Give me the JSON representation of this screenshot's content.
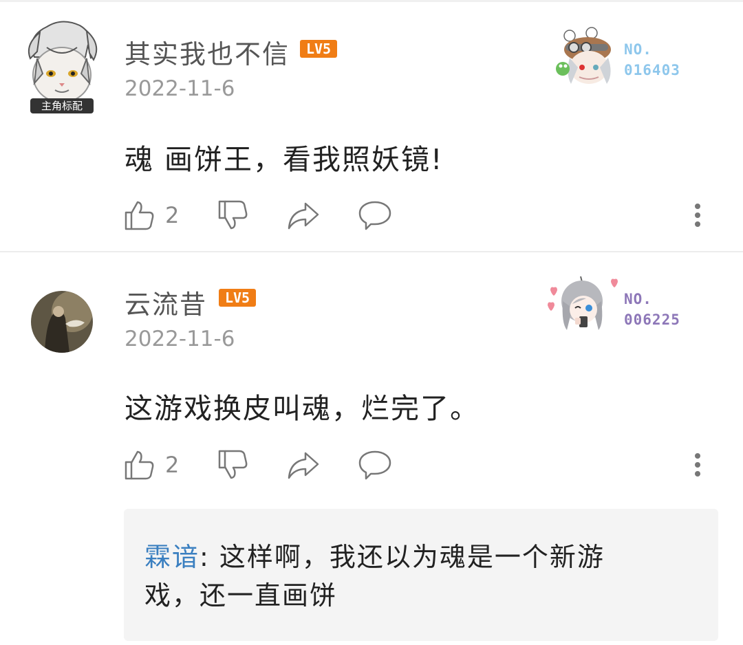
{
  "comments": [
    {
      "username": "其实我也不信",
      "level": "LV5",
      "avatar_badge": "主角标配",
      "date": "2022-11-6",
      "badge_no_label": "NO.",
      "badge_no_value": "016403",
      "text": "魂  画饼王，看我照妖镜!",
      "likes": "2"
    },
    {
      "username": "云流昔",
      "level": "LV5",
      "date": "2022-11-6",
      "badge_no_label": "NO.",
      "badge_no_value": "006225",
      "text": "这游戏换皮叫魂，烂完了。",
      "likes": "2",
      "reply": {
        "user": "霖谙",
        "separator": ": ",
        "text": "这样啊，我还以为魂是一个新游戏，还一直画饼"
      }
    }
  ],
  "icons": [
    "like-icon",
    "dislike-icon",
    "share-icon",
    "reply-icon",
    "more-icon"
  ],
  "colors": {
    "level_badge": "#f07d15",
    "badge_no_1": "#8ec7ec",
    "badge_no_2": "#8d77b8",
    "reply_user": "#3a7fc0"
  }
}
